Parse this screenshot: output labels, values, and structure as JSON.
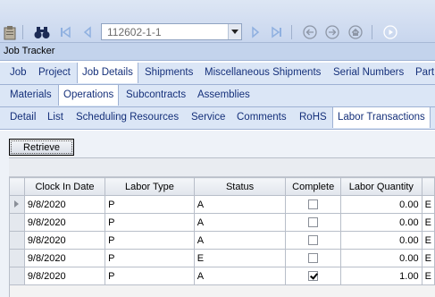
{
  "toolbar": {
    "icons": [
      "clipboard-icon",
      "binoculars-icon",
      "first-record-icon",
      "previous-record-icon",
      "dropdown-arrow-icon",
      "next-record-icon",
      "last-record-icon",
      "back-icon",
      "forward-icon",
      "home-icon",
      "play-icon"
    ],
    "record_value": "112602-1-1"
  },
  "window": {
    "title": "Job Tracker"
  },
  "tabs_main": [
    "Job",
    "Project",
    "Job Details",
    "Shipments",
    "Miscellaneous Shipments",
    "Serial Numbers",
    "Part"
  ],
  "tabs_sub": [
    "Materials",
    "Operations",
    "Subcontracts",
    "Assemblies"
  ],
  "tabs_ops": [
    "Detail",
    "List",
    "Scheduling Resources",
    "Service",
    "Comments",
    "RoHS",
    "Labor Transactions"
  ],
  "retrieve_label": "Retrieve",
  "grid": {
    "columns": [
      "Clock In Date",
      "Labor Type",
      "Status",
      "Complete",
      "Labor Quantity",
      ""
    ],
    "rows": [
      {
        "date": "9/8/2020",
        "type": "P",
        "status": "A",
        "complete": false,
        "qty": "0.00",
        "extra": "E"
      },
      {
        "date": "9/8/2020",
        "type": "P",
        "status": "A",
        "complete": false,
        "qty": "0.00",
        "extra": "E"
      },
      {
        "date": "9/8/2020",
        "type": "P",
        "status": "A",
        "complete": false,
        "qty": "0.00",
        "extra": "E"
      },
      {
        "date": "9/8/2020",
        "type": "P",
        "status": "E",
        "complete": false,
        "qty": "0.00",
        "extra": "E"
      },
      {
        "date": "9/8/2020",
        "type": "P",
        "status": "A",
        "complete": true,
        "qty": "1.00",
        "extra": "E"
      }
    ]
  },
  "colors": {
    "accent": "#15307a",
    "tab_bg": "#dbe6f6",
    "toolbar": "#c8d6ee"
  }
}
